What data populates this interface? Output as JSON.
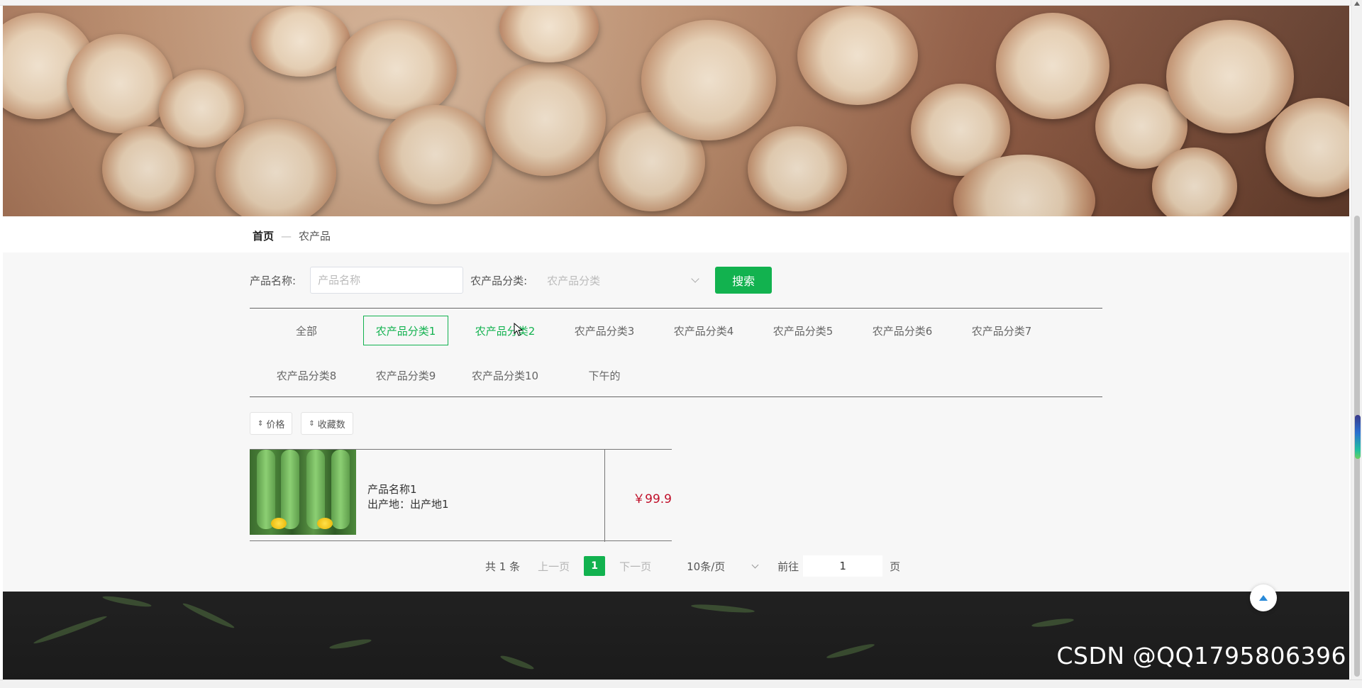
{
  "breadcrumb": {
    "home": "首页",
    "separator": "—",
    "current": "农产品"
  },
  "search": {
    "name_label": "产品名称:",
    "name_placeholder": "产品名称",
    "category_label": "农产品分类:",
    "category_placeholder": "农产品分类",
    "button": "搜索"
  },
  "categories": [
    {
      "label": "全部",
      "state": "normal"
    },
    {
      "label": "农产品分类1",
      "state": "active"
    },
    {
      "label": "农产品分类2",
      "state": "hover"
    },
    {
      "label": "农产品分类3",
      "state": "normal"
    },
    {
      "label": "农产品分类4",
      "state": "normal"
    },
    {
      "label": "农产品分类5",
      "state": "normal"
    },
    {
      "label": "农产品分类6",
      "state": "normal"
    },
    {
      "label": "农产品分类7",
      "state": "normal"
    },
    {
      "label": "农产品分类8",
      "state": "normal"
    },
    {
      "label": "农产品分类9",
      "state": "normal"
    },
    {
      "label": "农产品分类10",
      "state": "normal"
    },
    {
      "label": "下午的",
      "state": "normal"
    }
  ],
  "sort": {
    "price": "价格",
    "favorites": "收藏数",
    "icon": "sort-arrows-icon"
  },
  "products": [
    {
      "name": "产品名称1",
      "origin": "出产地：出产地1",
      "price": "￥99.9"
    }
  ],
  "pagination": {
    "total": "共 1 条",
    "prev": "上一页",
    "current": "1",
    "next": "下一页",
    "page_size": "10条/页",
    "goto_label": "前往",
    "goto_value": "1",
    "page_suffix": "页"
  },
  "watermark": "CSDN @QQ1795806396",
  "colors": {
    "accent": "#12b24f",
    "price": "#c0102a",
    "footer": "#1e1e1e"
  }
}
